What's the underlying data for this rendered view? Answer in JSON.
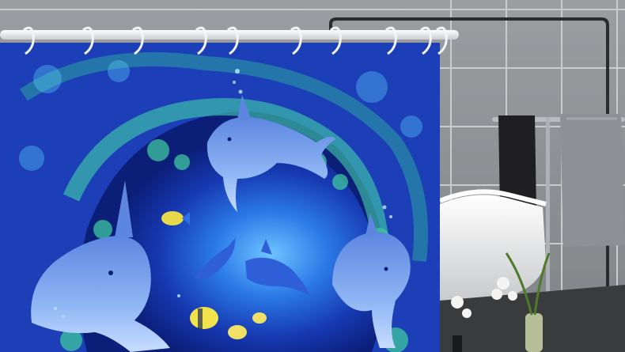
{
  "image": {
    "subject": "shower-curtain-product-photo",
    "curtain_print": "underwater-dolphin-cave",
    "palette": {
      "tile_wall": "#8c9194",
      "grout": "#c9cbcc",
      "rod": "#f3f4f5",
      "curtain_deep": "#0b1e78",
      "curtain_mid": "#1f4fd0",
      "coral_green": "#2fb89a",
      "glow": "#5fb6ff",
      "dolphin": "#6f9fea",
      "towel_dark": "#1f1f22",
      "towel_grey": "#8d9195",
      "tub": "#eeeeee",
      "floor": "#3a3b3d"
    },
    "hook_count": 10,
    "dolphin_count": 5
  }
}
